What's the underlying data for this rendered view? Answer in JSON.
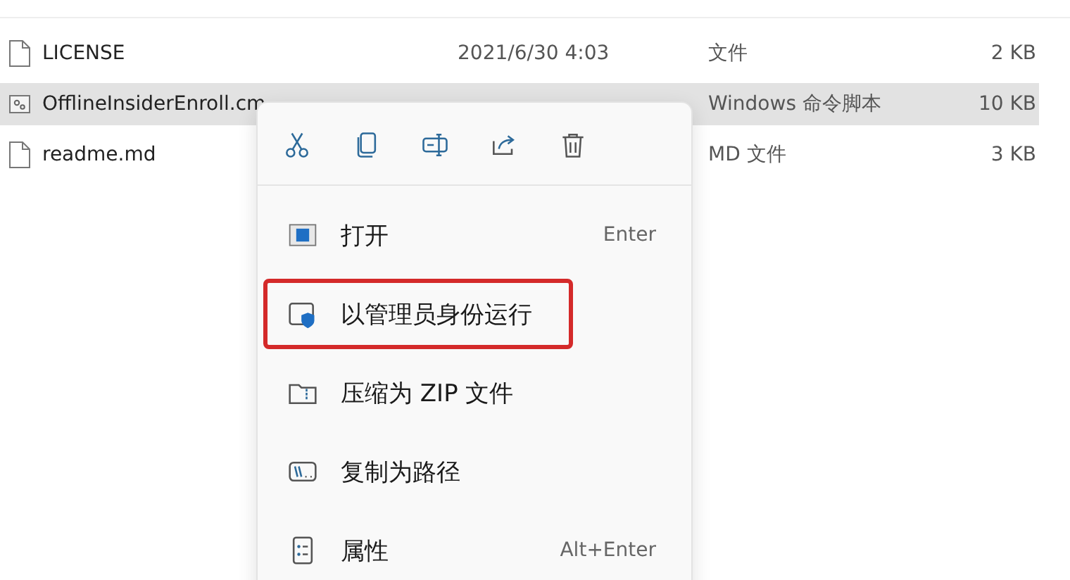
{
  "files": [
    {
      "name": "LICENSE",
      "modified": "2021/6/30 4:03",
      "type": "文件",
      "size": "2 KB",
      "kind": "document",
      "selected": false
    },
    {
      "name": "OfflineInsiderEnroll.cm",
      "type": "Windows 命令脚本",
      "size": "10 KB",
      "kind": "script",
      "selected": true
    },
    {
      "name": "readme.md",
      "type": "MD 文件",
      "size": "3 KB",
      "kind": "document",
      "selected": false
    }
  ],
  "context_menu": {
    "toolbar": [
      {
        "kind": "cut"
      },
      {
        "kind": "copy"
      },
      {
        "kind": "rename"
      },
      {
        "kind": "share"
      },
      {
        "kind": "delete"
      }
    ],
    "items": [
      {
        "label": "打开",
        "shortcut": "Enter",
        "kind": "open",
        "highlighted": false
      },
      {
        "label": "以管理员身份运行",
        "kind": "admin",
        "highlighted": true
      },
      {
        "label": "压缩为 ZIP 文件",
        "kind": "zip",
        "highlighted": false
      },
      {
        "label": "复制为路径",
        "kind": "path",
        "highlighted": false
      },
      {
        "label": "属性",
        "shortcut": "Alt+Enter",
        "kind": "properties",
        "highlighted": false
      }
    ]
  }
}
